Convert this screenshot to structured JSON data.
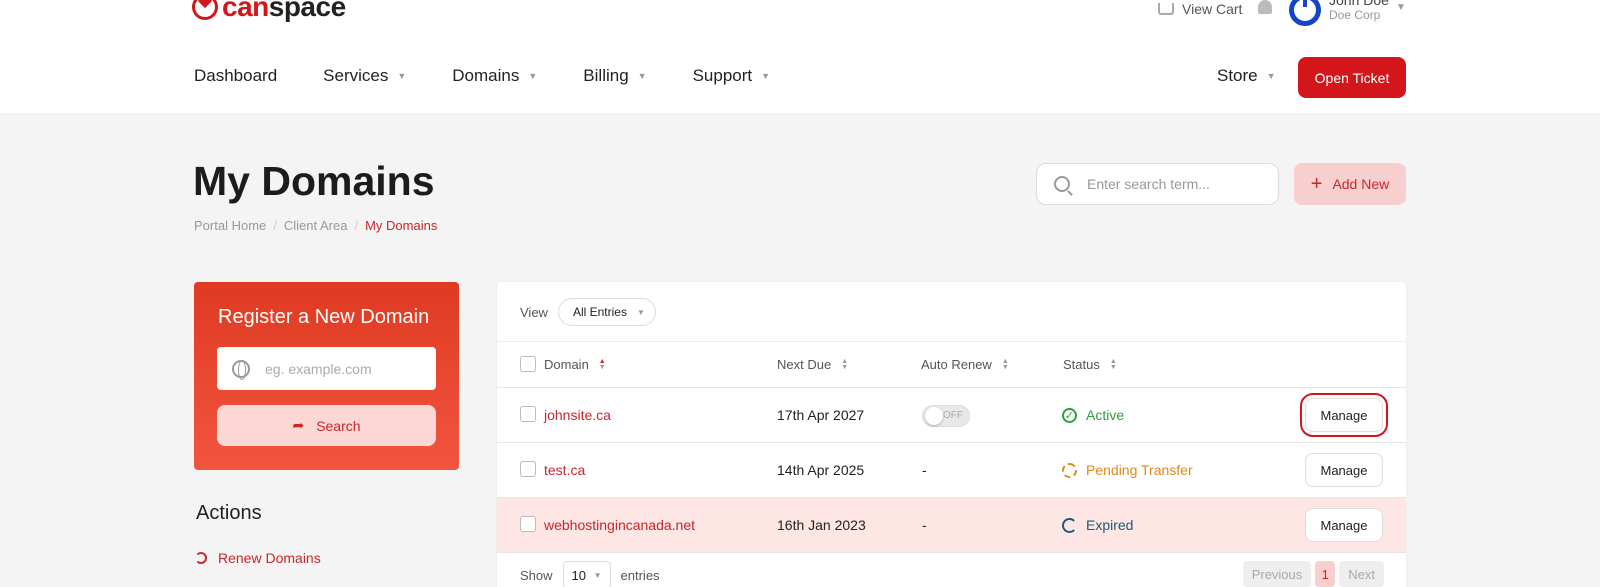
{
  "header": {
    "logo_red": "can",
    "logo_dark": "space",
    "view_cart": "View Cart",
    "user_name": "John Doe",
    "user_company": "Doe Corp"
  },
  "nav": {
    "items": [
      {
        "label": "Dashboard"
      },
      {
        "label": "Services"
      },
      {
        "label": "Domains"
      },
      {
        "label": "Billing"
      },
      {
        "label": "Support"
      }
    ],
    "store": "Store",
    "open_ticket": "Open Ticket"
  },
  "page": {
    "title": "My Domains",
    "breadcrumb": [
      "Portal Home",
      "Client Area",
      "My Domains"
    ],
    "search_placeholder": "Enter search term...",
    "add_new": "Add New"
  },
  "register": {
    "title": "Register a New Domain",
    "placeholder": "eg. example.com",
    "search_label": "Search"
  },
  "actions": {
    "title": "Actions",
    "renew": "Renew Domains"
  },
  "table": {
    "view_label": "View",
    "view_value": "All Entries",
    "columns": [
      "Domain",
      "Next Due",
      "Auto Renew",
      "Status"
    ],
    "rows": [
      {
        "domain": "johnsite.ca",
        "next_due": "17th Apr 2027",
        "auto_renew": "OFF",
        "status": "Active",
        "manage": "Manage"
      },
      {
        "domain": "test.ca",
        "next_due": "14th Apr 2025",
        "auto_renew": "-",
        "status": "Pending Transfer",
        "manage": "Manage"
      },
      {
        "domain": "webhostingincanada.net",
        "next_due": "16th Jan 2023",
        "auto_renew": "-",
        "status": "Expired",
        "manage": "Manage"
      }
    ],
    "show_label": "Show",
    "page_length": "10",
    "entries_label": "entries",
    "pager": {
      "previous": "Previous",
      "current": "1",
      "next": "Next"
    }
  },
  "colors": {
    "brand_red": "#d3161b",
    "active_green": "#2e9e3e",
    "pending_orange": "#e08a1a",
    "expired_teal": "#195c74"
  }
}
